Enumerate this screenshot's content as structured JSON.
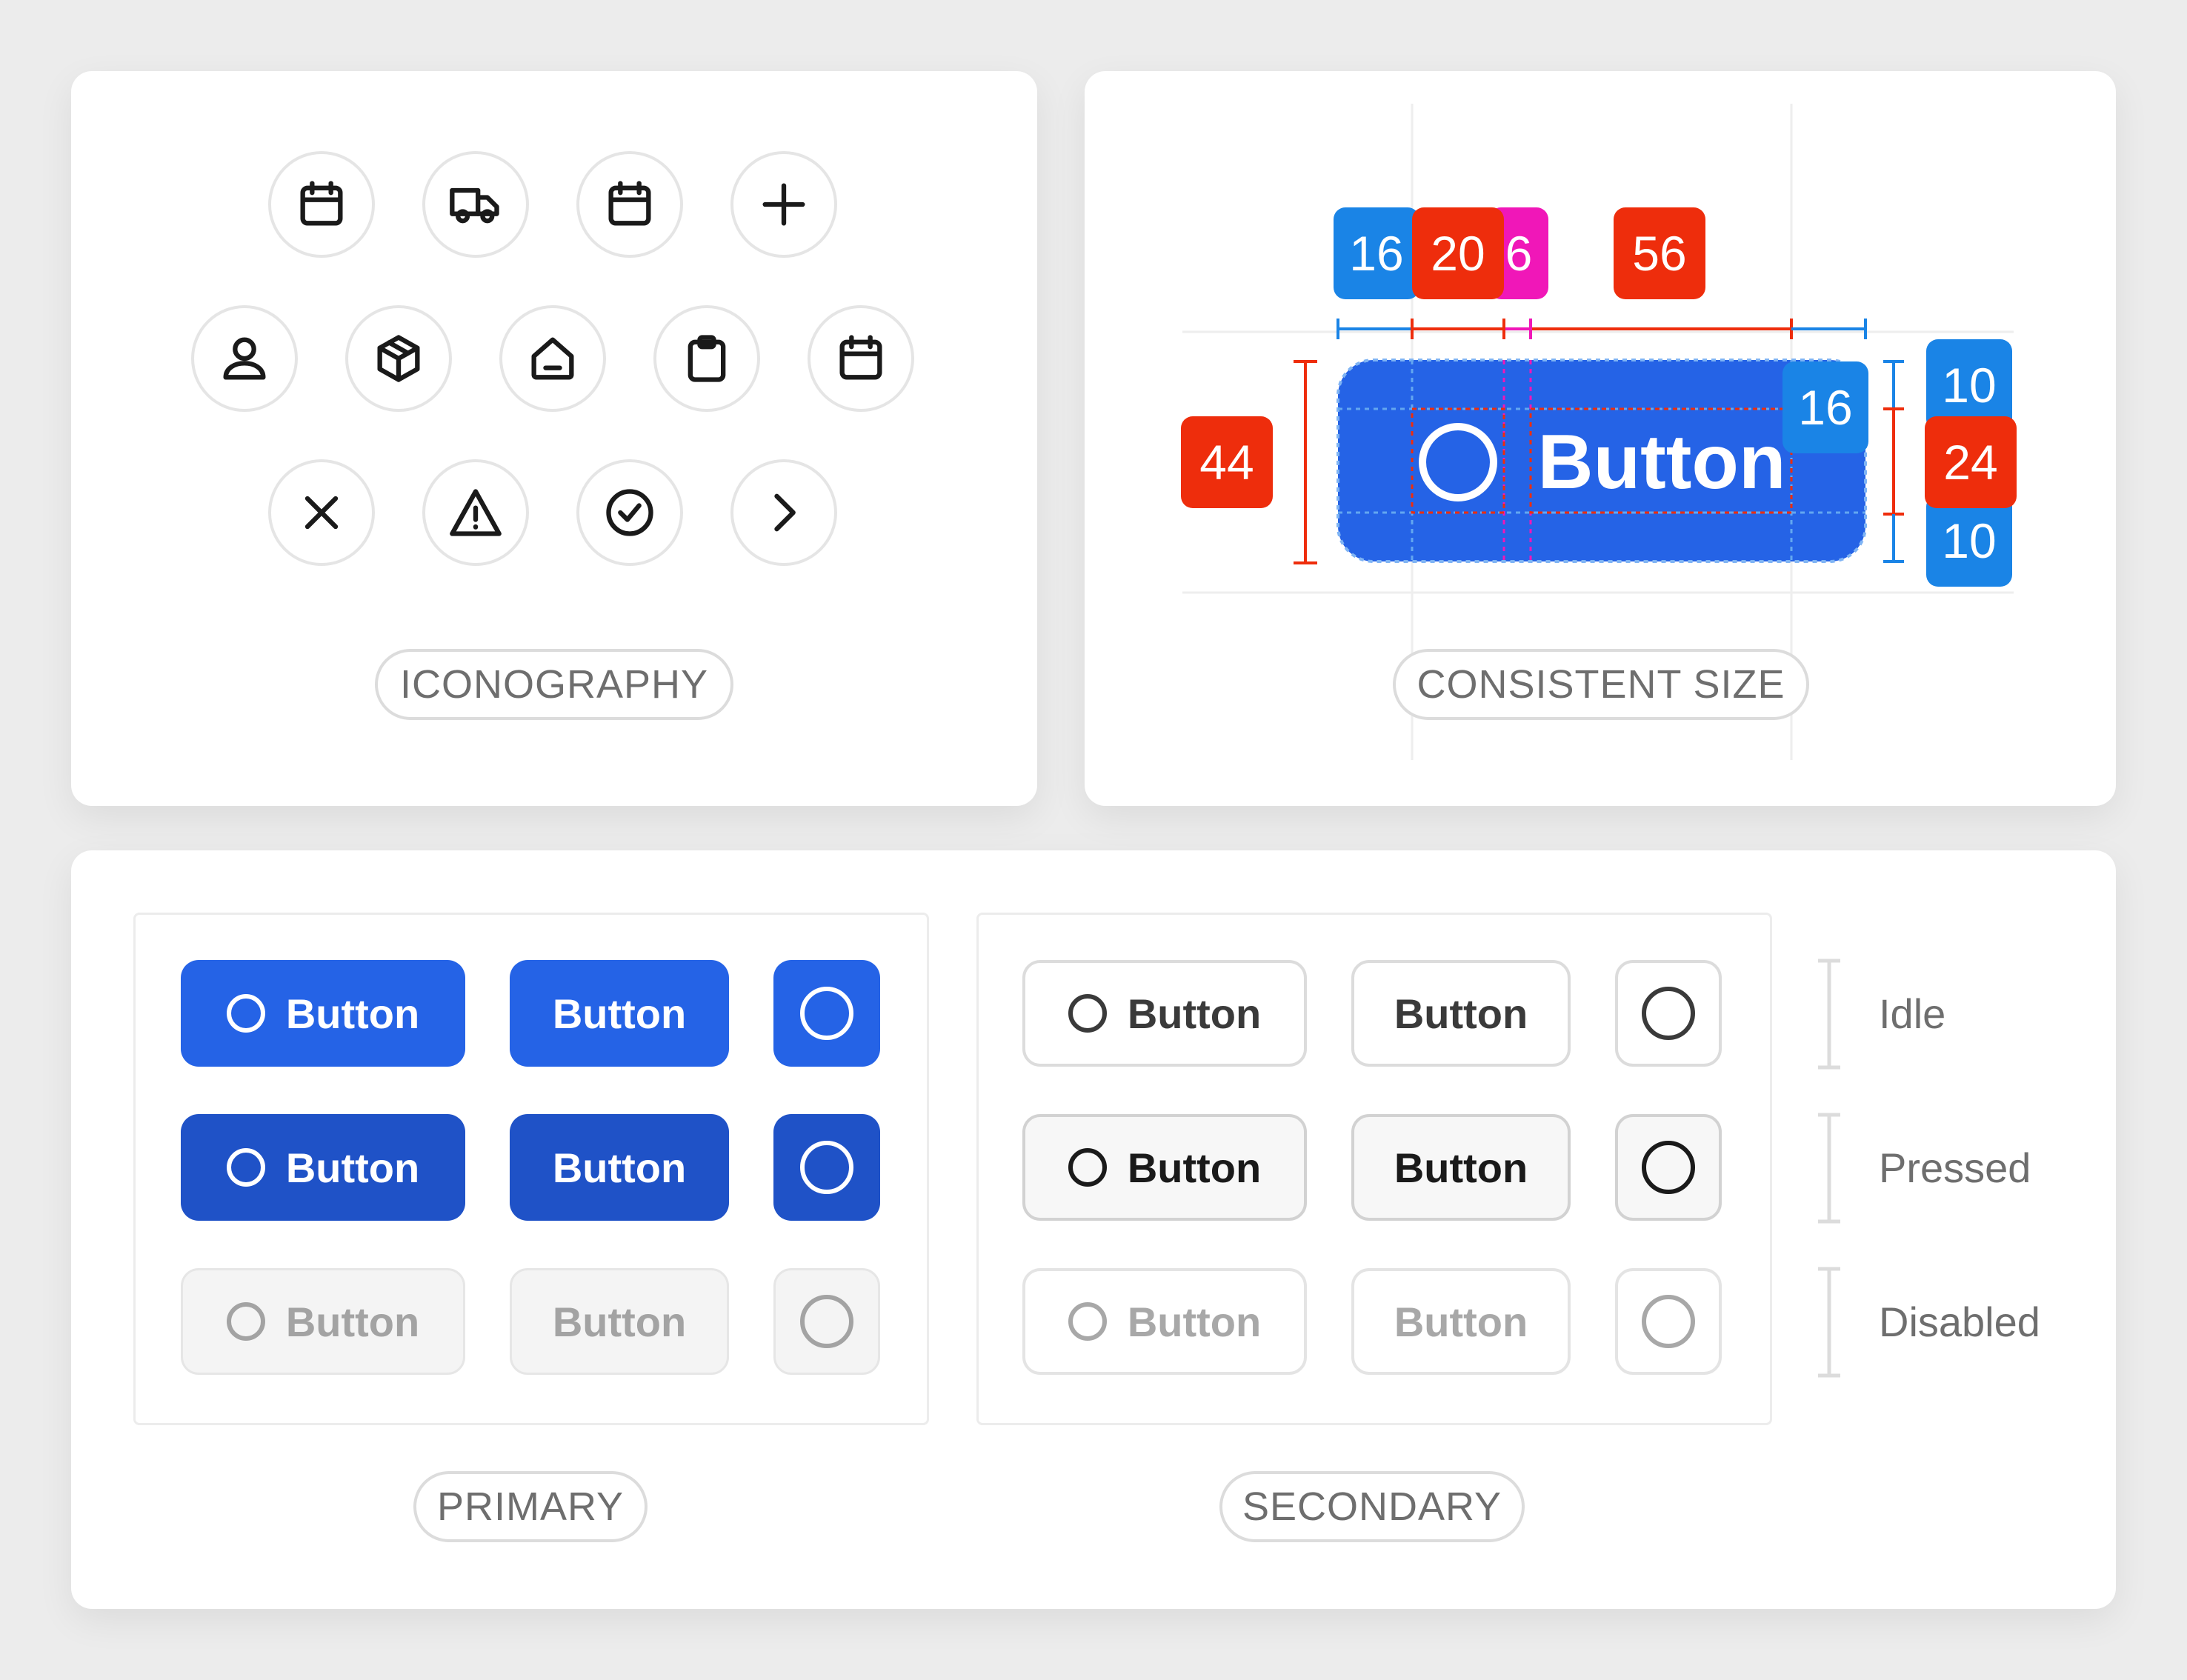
{
  "colors": {
    "primary": "#2563e6",
    "primary_pressed": "#1f52c7",
    "measure_blue": "#1a84e6",
    "measure_red": "#ee2d0c",
    "measure_pink": "#f017b8",
    "background": "#ececec"
  },
  "iconography": {
    "label": "ICONOGRAPHY",
    "icons": [
      "calendar-icon",
      "truck-icon",
      "calendar-icon",
      "plus-icon",
      "user-icon",
      "box-icon",
      "home-icon",
      "clipboard-icon",
      "calendar-icon",
      "close-icon",
      "warning-icon",
      "check-circle-icon",
      "chevron-right-icon"
    ]
  },
  "consistent_size": {
    "label": "CONSISTENT SIZE",
    "button_label": "Button",
    "top_measures": [
      "16",
      "20",
      "6",
      "56"
    ],
    "inner_padding": "16",
    "height": "44",
    "right_measures": [
      "10",
      "24",
      "10"
    ]
  },
  "buttons": {
    "label": "Button",
    "primary_label": "PRIMARY",
    "secondary_label": "SECONDARY",
    "states": [
      "Idle",
      "Pressed",
      "Disabled"
    ]
  }
}
